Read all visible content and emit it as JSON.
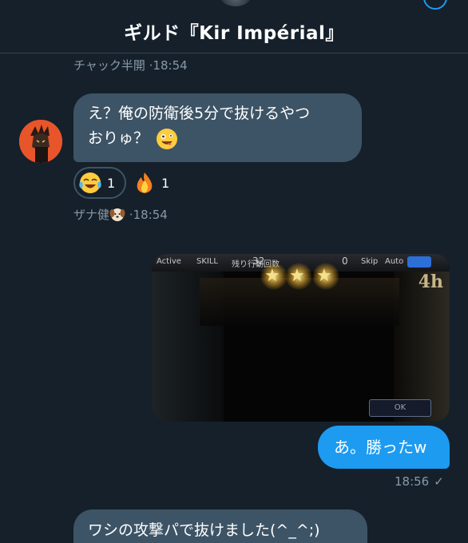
{
  "header": {
    "title": "ギルド『Kir Impérial』"
  },
  "messages": [
    {
      "id": "prev-meta",
      "sender": "チャック半開",
      "time": "18:54"
    },
    {
      "id": "m1",
      "direction": "incoming",
      "lines": [
        "え？俺の防衛後5分で抜けるやつ",
        "おりゅ？"
      ],
      "trailing_emoji": "zany-face-emoji",
      "reactions": [
        {
          "emoji": "tears-of-joy-emoji",
          "count": "1",
          "selected": true
        },
        {
          "emoji": "fire-emoji",
          "count": "1",
          "selected": false
        }
      ],
      "sender": "ザナ健",
      "sender_badge_emoji": "dog-face-emoji",
      "time": "18:54"
    },
    {
      "id": "m2",
      "direction": "outgoing",
      "type": "image",
      "image": {
        "hud_left": "Active",
        "hud_mid": "SKILL",
        "hud_count_label": "残り行動回数",
        "hud_count_value": "32",
        "hud_zero": "0",
        "hud_skip": "Skip",
        "hud_auto": "Auto",
        "corner_text": "4h",
        "ok_label": "OK",
        "stars": 3
      }
    },
    {
      "id": "m3",
      "direction": "outgoing",
      "text": "あ。勝ったw",
      "time": "18:56",
      "status_icon": "checkmark-icon"
    },
    {
      "id": "m4",
      "direction": "incoming",
      "text": "ワシの攻撃パで抜けました(^_^;)"
    }
  ],
  "colors": {
    "background": "#15202b",
    "incoming_bubble": "#3d5466",
    "outgoing_bubble": "#1d9bf0",
    "meta_text": "#8899a6",
    "divider": "#38444d"
  }
}
